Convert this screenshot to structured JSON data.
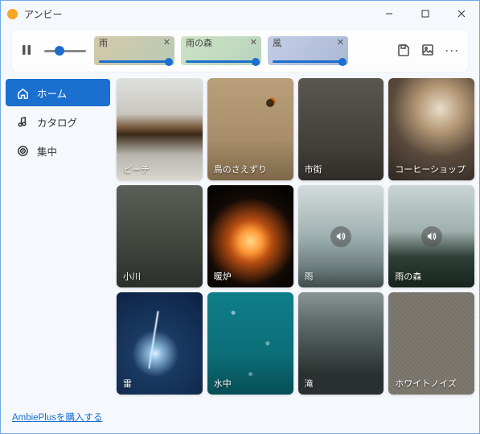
{
  "window": {
    "title": "アンビー"
  },
  "toolbar": {
    "chips": [
      {
        "label": "雨"
      },
      {
        "label": "雨の森"
      },
      {
        "label": "風"
      }
    ]
  },
  "sidebar": {
    "items": [
      {
        "label": "ホーム",
        "icon": "home"
      },
      {
        "label": "カタログ",
        "icon": "music-note"
      },
      {
        "label": "集中",
        "icon": "target"
      }
    ],
    "footer_link": "AmbiePlusを購入する"
  },
  "cards": [
    {
      "label": "ビーチ",
      "bg": "bg-beach",
      "playing": false
    },
    {
      "label": "鳥のさえずり",
      "bg": "bg-birds",
      "playing": false
    },
    {
      "label": "市街",
      "bg": "bg-city",
      "playing": false
    },
    {
      "label": "コーヒーショップ",
      "bg": "bg-coffee",
      "playing": false
    },
    {
      "label": "小川",
      "bg": "bg-creek",
      "playing": false
    },
    {
      "label": "暖炉",
      "bg": "bg-fire",
      "playing": false
    },
    {
      "label": "雨",
      "bg": "bg-rain",
      "playing": true
    },
    {
      "label": "雨の森",
      "bg": "bg-rainforest",
      "playing": true
    },
    {
      "label": "雷",
      "bg": "bg-thunder",
      "playing": false
    },
    {
      "label": "水中",
      "bg": "bg-water",
      "playing": false
    },
    {
      "label": "滝",
      "bg": "bg-falls",
      "playing": false
    },
    {
      "label": "ホワイトノイズ",
      "bg": "bg-white",
      "playing": false
    }
  ]
}
